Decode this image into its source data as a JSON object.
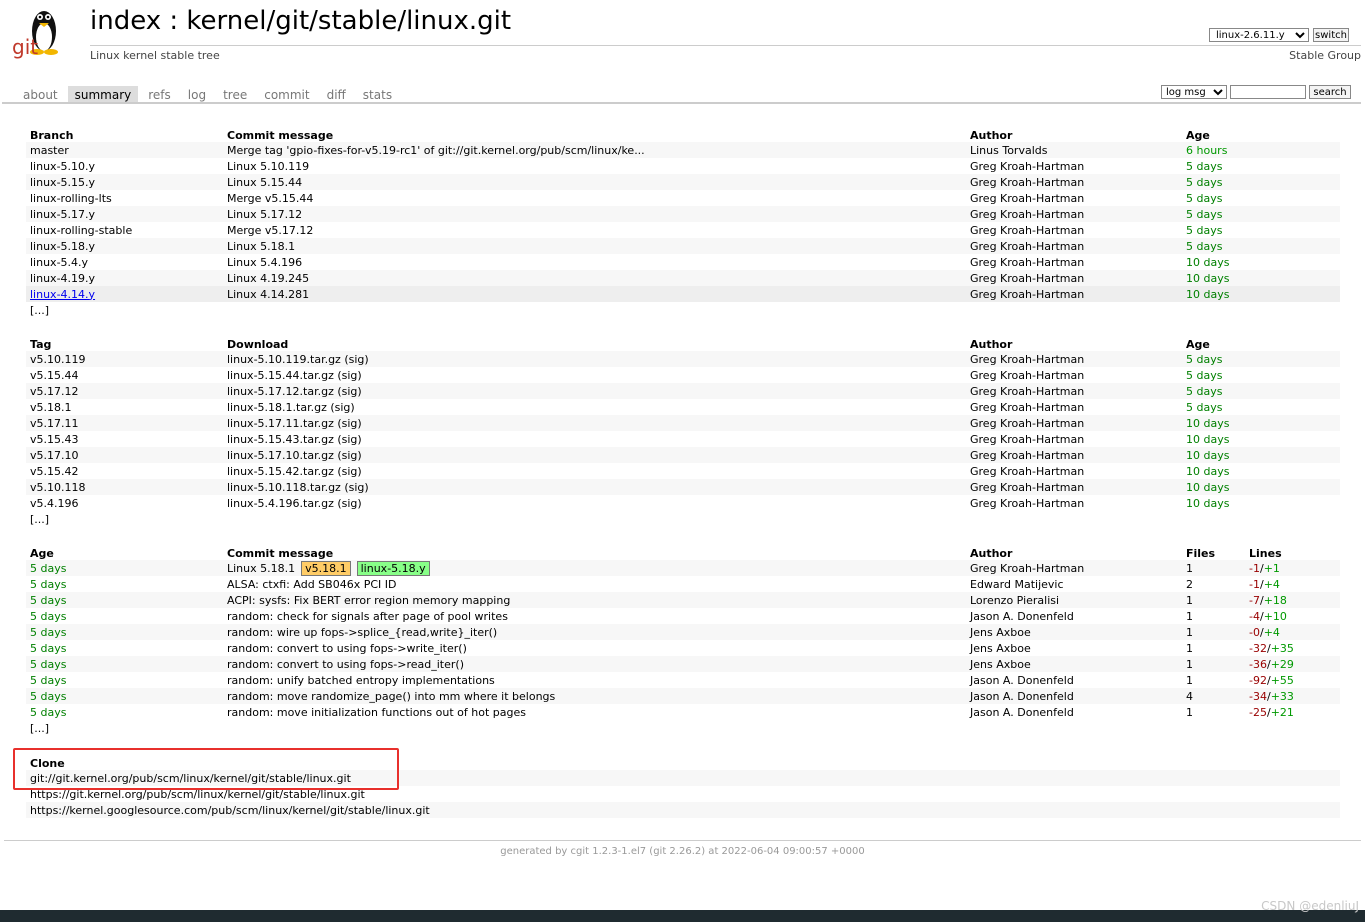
{
  "header": {
    "title": "index : kernel/git/stable/linux.git",
    "subtitle": "Linux kernel stable tree",
    "branch_select": "linux-2.6.11.y",
    "switch_label": "switch",
    "owner": "Stable Group",
    "logo_text": "git"
  },
  "tabs": [
    "about",
    "summary",
    "refs",
    "log",
    "tree",
    "commit",
    "diff",
    "stats"
  ],
  "search": {
    "select": "log msg",
    "button": "search"
  },
  "branches": {
    "headers": [
      "Branch",
      "Commit message",
      "Author",
      "Age"
    ],
    "rows": [
      [
        "master",
        "Merge tag 'gpio-fixes-for-v5.19-rc1' of git://git.kernel.org/pub/scm/linux/ke...",
        "Linus Torvalds",
        "6 hours"
      ],
      [
        "linux-5.10.y",
        "Linux 5.10.119",
        "Greg Kroah-Hartman",
        "5 days"
      ],
      [
        "linux-5.15.y",
        "Linux 5.15.44",
        "Greg Kroah-Hartman",
        "5 days"
      ],
      [
        "linux-rolling-lts",
        "Merge v5.15.44",
        "Greg Kroah-Hartman",
        "5 days"
      ],
      [
        "linux-5.17.y",
        "Linux 5.17.12",
        "Greg Kroah-Hartman",
        "5 days"
      ],
      [
        "linux-rolling-stable",
        "Merge v5.17.12",
        "Greg Kroah-Hartman",
        "5 days"
      ],
      [
        "linux-5.18.y",
        "Linux 5.18.1",
        "Greg Kroah-Hartman",
        "5 days"
      ],
      [
        "linux-5.4.y",
        "Linux 5.4.196",
        "Greg Kroah-Hartman",
        "10 days"
      ],
      [
        "linux-4.19.y",
        "Linux 4.19.245",
        "Greg Kroah-Hartman",
        "10 days"
      ],
      [
        "linux-4.14.y",
        "Linux 4.14.281",
        "Greg Kroah-Hartman",
        "10 days"
      ]
    ],
    "more": "[...]"
  },
  "tags": {
    "headers": [
      "Tag",
      "Download",
      "Author",
      "Age"
    ],
    "rows": [
      [
        "v5.10.119",
        "linux-5.10.119.tar.gz (sig)",
        "Greg Kroah-Hartman",
        "5 days"
      ],
      [
        "v5.15.44",
        "linux-5.15.44.tar.gz (sig)",
        "Greg Kroah-Hartman",
        "5 days"
      ],
      [
        "v5.17.12",
        "linux-5.17.12.tar.gz (sig)",
        "Greg Kroah-Hartman",
        "5 days"
      ],
      [
        "v5.18.1",
        "linux-5.18.1.tar.gz (sig)",
        "Greg Kroah-Hartman",
        "5 days"
      ],
      [
        "v5.17.11",
        "linux-5.17.11.tar.gz (sig)",
        "Greg Kroah-Hartman",
        "10 days"
      ],
      [
        "v5.15.43",
        "linux-5.15.43.tar.gz (sig)",
        "Greg Kroah-Hartman",
        "10 days"
      ],
      [
        "v5.17.10",
        "linux-5.17.10.tar.gz (sig)",
        "Greg Kroah-Hartman",
        "10 days"
      ],
      [
        "v5.15.42",
        "linux-5.15.42.tar.gz (sig)",
        "Greg Kroah-Hartman",
        "10 days"
      ],
      [
        "v5.10.118",
        "linux-5.10.118.tar.gz (sig)",
        "Greg Kroah-Hartman",
        "10 days"
      ],
      [
        "v5.4.196",
        "linux-5.4.196.tar.gz (sig)",
        "Greg Kroah-Hartman",
        "10 days"
      ]
    ],
    "more": "[...]"
  },
  "commits": {
    "headers": [
      "Age",
      "Commit message",
      "Author",
      "Files",
      "Lines"
    ],
    "rows": [
      {
        "age": "5 days",
        "msg": "Linux 5.18.1",
        "tag": "v5.18.1",
        "branch": "linux-5.18.y",
        "author": "Greg Kroah-Hartman",
        "files": "1",
        "del": "-1",
        "add": "+1"
      },
      {
        "age": "5 days",
        "msg": "ALSA: ctxfi: Add SB046x PCI ID",
        "author": "Edward Matijevic",
        "files": "2",
        "del": "-1",
        "add": "+4"
      },
      {
        "age": "5 days",
        "msg": "ACPI: sysfs: Fix BERT error region memory mapping",
        "author": "Lorenzo Pieralisi",
        "files": "1",
        "del": "-7",
        "add": "+18"
      },
      {
        "age": "5 days",
        "msg": "random: check for signals after page of pool writes",
        "author": "Jason A. Donenfeld",
        "files": "1",
        "del": "-4",
        "add": "+10"
      },
      {
        "age": "5 days",
        "msg": "random: wire up fops->splice_{read,write}_iter()",
        "author": "Jens Axboe",
        "files": "1",
        "del": "-0",
        "add": "+4"
      },
      {
        "age": "5 days",
        "msg": "random: convert to using fops->write_iter()",
        "author": "Jens Axboe",
        "files": "1",
        "del": "-32",
        "add": "+35"
      },
      {
        "age": "5 days",
        "msg": "random: convert to using fops->read_iter()",
        "author": "Jens Axboe",
        "files": "1",
        "del": "-36",
        "add": "+29"
      },
      {
        "age": "5 days",
        "msg": "random: unify batched entropy implementations",
        "author": "Jason A. Donenfeld",
        "files": "1",
        "del": "-92",
        "add": "+55"
      },
      {
        "age": "5 days",
        "msg": "random: move randomize_page() into mm where it belongs",
        "author": "Jason A. Donenfeld",
        "files": "4",
        "del": "-34",
        "add": "+33"
      },
      {
        "age": "5 days",
        "msg": "random: move initialization functions out of hot pages",
        "author": "Jason A. Donenfeld",
        "files": "1",
        "del": "-25",
        "add": "+21"
      }
    ],
    "more": "[...]"
  },
  "clone": {
    "header": "Clone",
    "urls": [
      "git://git.kernel.org/pub/scm/linux/kernel/git/stable/linux.git",
      "https://git.kernel.org/pub/scm/linux/kernel/git/stable/linux.git",
      "https://kernel.googlesource.com/pub/scm/linux/kernel/git/stable/linux.git"
    ]
  },
  "footer": "generated by cgit 1.2.3-1.el7 (git 2.26.2) at 2022-06-04 09:00:57 +0000",
  "watermark": "CSDN @edenliuJ",
  "colors": {
    "tag_deco": "#ffcc66",
    "branch_deco": "#88ff88",
    "highlight_box": "#e8302c",
    "age_green": "#009900",
    "del_red": "#990000"
  }
}
